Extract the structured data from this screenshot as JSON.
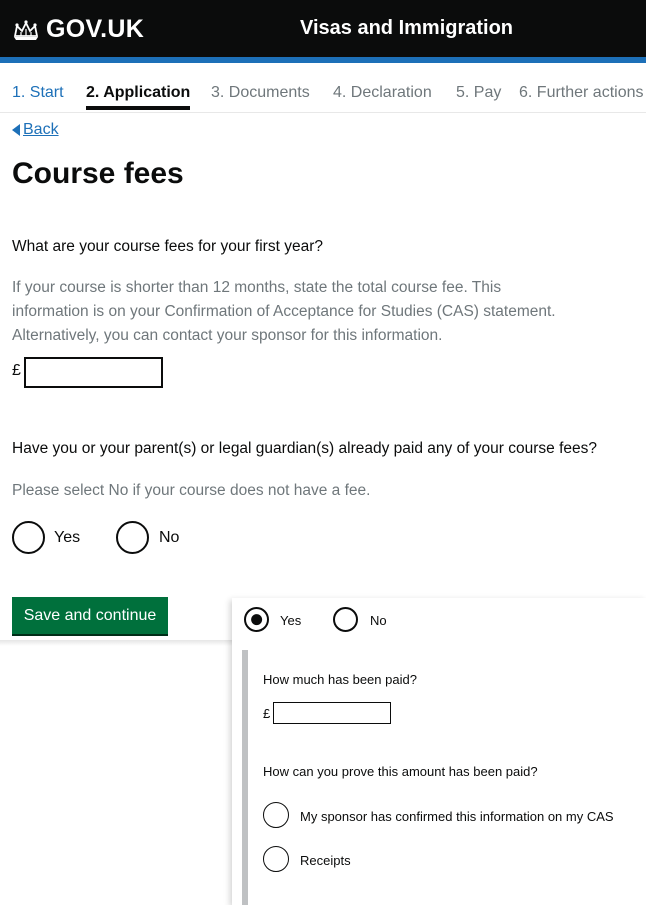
{
  "header": {
    "logo_text": "GOV.UK",
    "logo_icon": "crown-icon",
    "service_name": "Visas and Immigration",
    "accent_color": "#1d70b8"
  },
  "steps": [
    {
      "label": "1. Start",
      "state": "done"
    },
    {
      "label": "2. Application",
      "state": "current"
    },
    {
      "label": "3. Documents",
      "state": "upcoming"
    },
    {
      "label": "4. Declaration",
      "state": "upcoming"
    },
    {
      "label": "5. Pay",
      "state": "upcoming"
    },
    {
      "label": "6. Further actions",
      "state": "upcoming"
    }
  ],
  "back_label": "Back",
  "page_title": "Course fees",
  "fees_question": {
    "label": "What are your course fees for your first year?",
    "hint_lines": [
      "If your course is shorter than 12 months, state the total course fee. This",
      "information is on your Confirmation of Acceptance for Studies (CAS) statement.",
      "Alternatively, you can contact your sponsor for this information."
    ],
    "currency": "£",
    "value": ""
  },
  "paid_question": {
    "label": "Have you or your parent(s) or legal guardian(s) already paid any of your course fees?",
    "hint": "Please select No if your course does not have a fee.",
    "options": [
      {
        "label": "Yes",
        "selected": false
      },
      {
        "label": "No",
        "selected": false
      }
    ]
  },
  "save_button_label": "Save and continue",
  "button_color": "#00703c",
  "expanded": {
    "options": [
      {
        "label": "Yes",
        "selected": true
      },
      {
        "label": "No",
        "selected": false
      }
    ],
    "amount_question": "How much has been paid?",
    "currency": "£",
    "amount_value": "",
    "proof_question": "How can you prove this amount has been paid?",
    "proof_options": [
      {
        "label": "My sponsor has confirmed this information on my CAS",
        "selected": false
      },
      {
        "label": "Receipts",
        "selected": false
      }
    ]
  }
}
